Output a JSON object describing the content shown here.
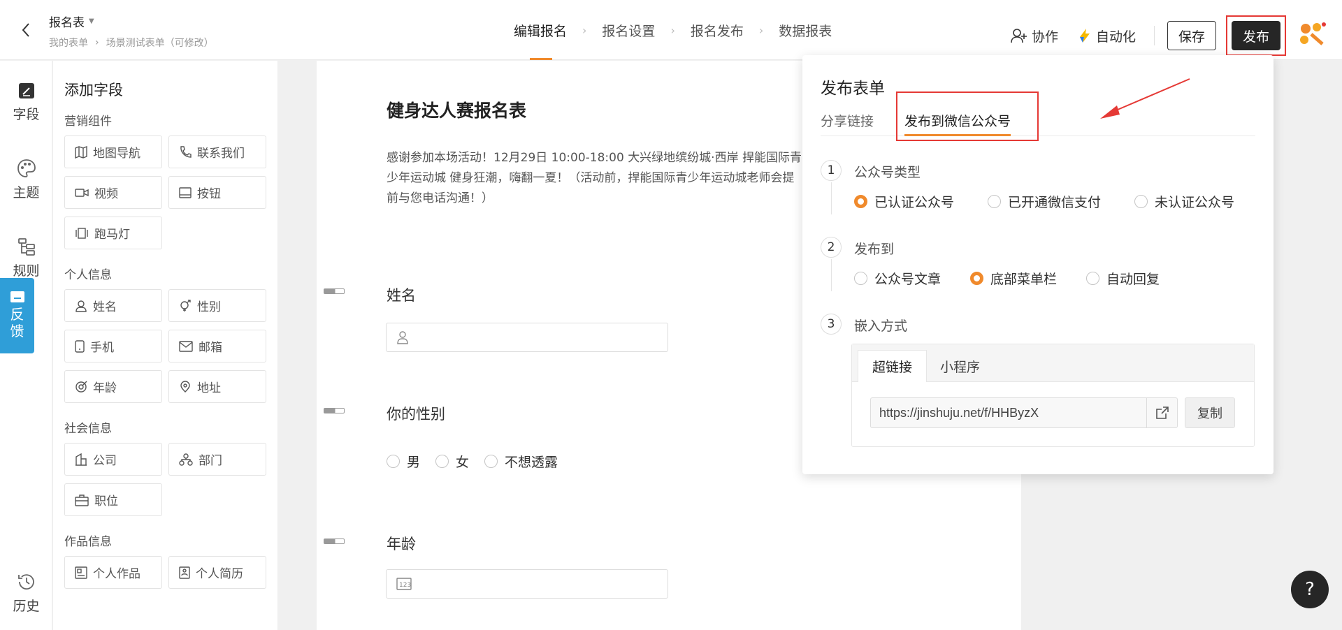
{
  "header": {
    "form_title": "报名表",
    "breadcrumb": [
      "我的表单",
      "场景测试表单（可修改）"
    ],
    "steps": [
      "编辑报名",
      "报名设置",
      "报名发布",
      "数据报表"
    ],
    "collab_label": "协作",
    "automation_label": "自动化",
    "save_label": "保存",
    "publish_label": "发布"
  },
  "rail": {
    "fields": "字段",
    "theme": "主题",
    "rules": "规则",
    "feedback": "反馈",
    "history": "历史"
  },
  "field_panel": {
    "title": "添加字段",
    "groups": [
      {
        "title": "营销组件",
        "items": [
          "地图导航",
          "联系我们",
          "视频",
          "按钮",
          "跑马灯"
        ]
      },
      {
        "title": "个人信息",
        "items": [
          "姓名",
          "性别",
          "手机",
          "邮箱",
          "年龄",
          "地址"
        ]
      },
      {
        "title": "社会信息",
        "items": [
          "公司",
          "部门",
          "职位"
        ]
      },
      {
        "title": "作品信息",
        "items": [
          "个人作品",
          "个人简历"
        ]
      }
    ]
  },
  "form": {
    "title": "健身达人赛报名表",
    "description": "感谢参加本场活动！12月29日 10:00-18:00 大兴绿地缤纷城·西岸 捍能国际青少年运动城 健身狂潮，嗨翻一夏！（活动前，捍能国际青少年运动城老师会提前与您电话沟通！）",
    "q_name": "姓名",
    "q_gender": "你的性别",
    "gender_options": [
      "男",
      "女",
      "不想透露"
    ],
    "q_age": "年龄"
  },
  "popover": {
    "title": "发布表单",
    "tabs": [
      "分享链接",
      "发布到微信公众号"
    ],
    "step1": {
      "num": "1",
      "title": "公众号类型",
      "options": [
        "已认证公众号",
        "已开通微信支付",
        "未认证公众号"
      ],
      "selected": "已认证公众号"
    },
    "step2": {
      "num": "2",
      "title": "发布到",
      "options": [
        "公众号文章",
        "底部菜单栏",
        "自动回复"
      ],
      "selected": "底部菜单栏"
    },
    "step3": {
      "num": "3",
      "title": "嵌入方式",
      "tabs": [
        "超链接",
        "小程序"
      ]
    },
    "url": "https://jinshuju.net/f/HHByzX",
    "copy_label": "复制"
  },
  "help_label": "?",
  "colors": {
    "accent": "#f08a2c",
    "highlight": "#e53935",
    "feedback_bg": "#2f9ed8",
    "dark": "#262626"
  }
}
